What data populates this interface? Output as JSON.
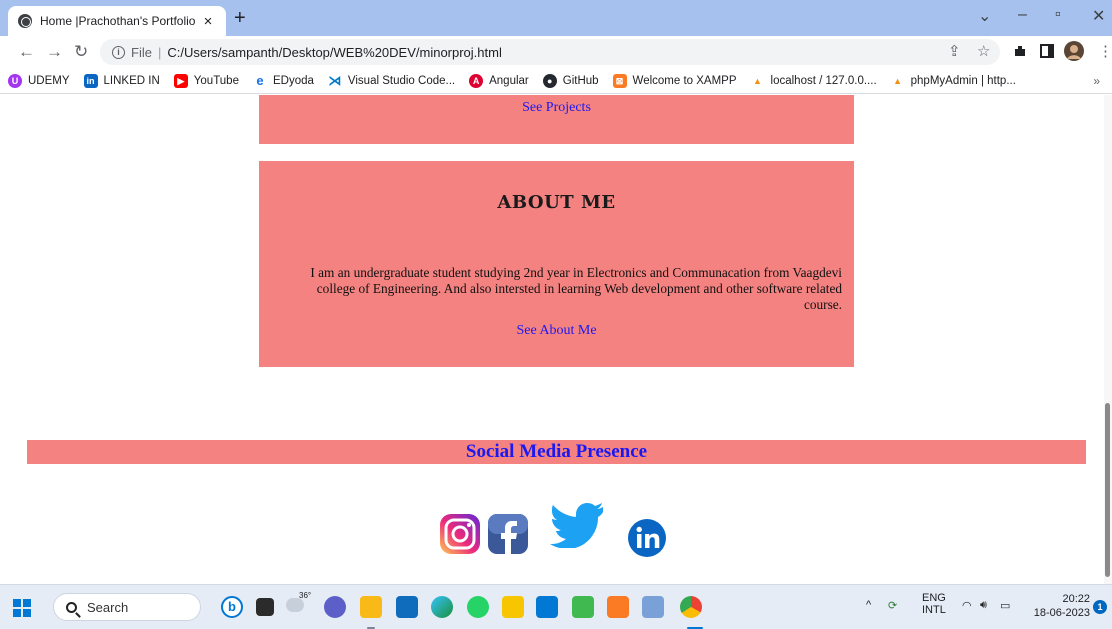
{
  "browser": {
    "tab_title": "Home |Prachothan's Portfolio",
    "tab_close": "×",
    "new_tab": "+",
    "url_scheme_label": "File",
    "url": "C:/Users/sampanth/Desktop/WEB%20DEV/minorproj.html",
    "bookmarks": [
      {
        "label": "UDEMY",
        "icon": "udemy-icon",
        "color": "#a435f0"
      },
      {
        "label": "LINKED IN",
        "icon": "linkedin-icon",
        "color": "#0a66c2"
      },
      {
        "label": "YouTube",
        "icon": "youtube-icon",
        "color": "#ff0000"
      },
      {
        "label": "EDyoda",
        "icon": "edyoda-icon",
        "color": "#1a73e8"
      },
      {
        "label": "Visual Studio Code...",
        "icon": "vscode-icon",
        "color": "#007acc"
      },
      {
        "label": "Angular",
        "icon": "angular-icon",
        "color": "#dd0031"
      },
      {
        "label": "GitHub",
        "icon": "github-icon",
        "color": "#24292f"
      },
      {
        "label": "Welcome to XAMPP",
        "icon": "xampp-icon",
        "color": "#fb7a24"
      },
      {
        "label": "localhost / 127.0.0....",
        "icon": "phpmyadmin-icon",
        "color": "#f29111"
      },
      {
        "label": "phpMyAdmin | http...",
        "icon": "phpmyadmin-icon",
        "color": "#f29111"
      }
    ],
    "bookmarks_more": "»"
  },
  "page": {
    "top_card_link": "See Projects",
    "about_title": "ABOUT ME",
    "about_text": "I am an undergraduate student studying 2nd year in Electronics and Communacation from Vaagdevi college of Engineering. And also intersted in learning Web development and other software related course.",
    "about_link": "See About Me",
    "social_heading": "Social Media Presence",
    "social_icons": [
      "instagram-icon",
      "facebook-icon",
      "twitter-icon",
      "linkedin-icon"
    ],
    "colors": {
      "card": "#f48281",
      "link": "#1b19f2"
    }
  },
  "taskbar": {
    "search_placeholder": "Search",
    "weather_temp": "36°",
    "lang_top": "ENG",
    "lang_bottom": "INTL",
    "time": "20:22",
    "date": "18-06-2023",
    "notification_count": "1"
  }
}
